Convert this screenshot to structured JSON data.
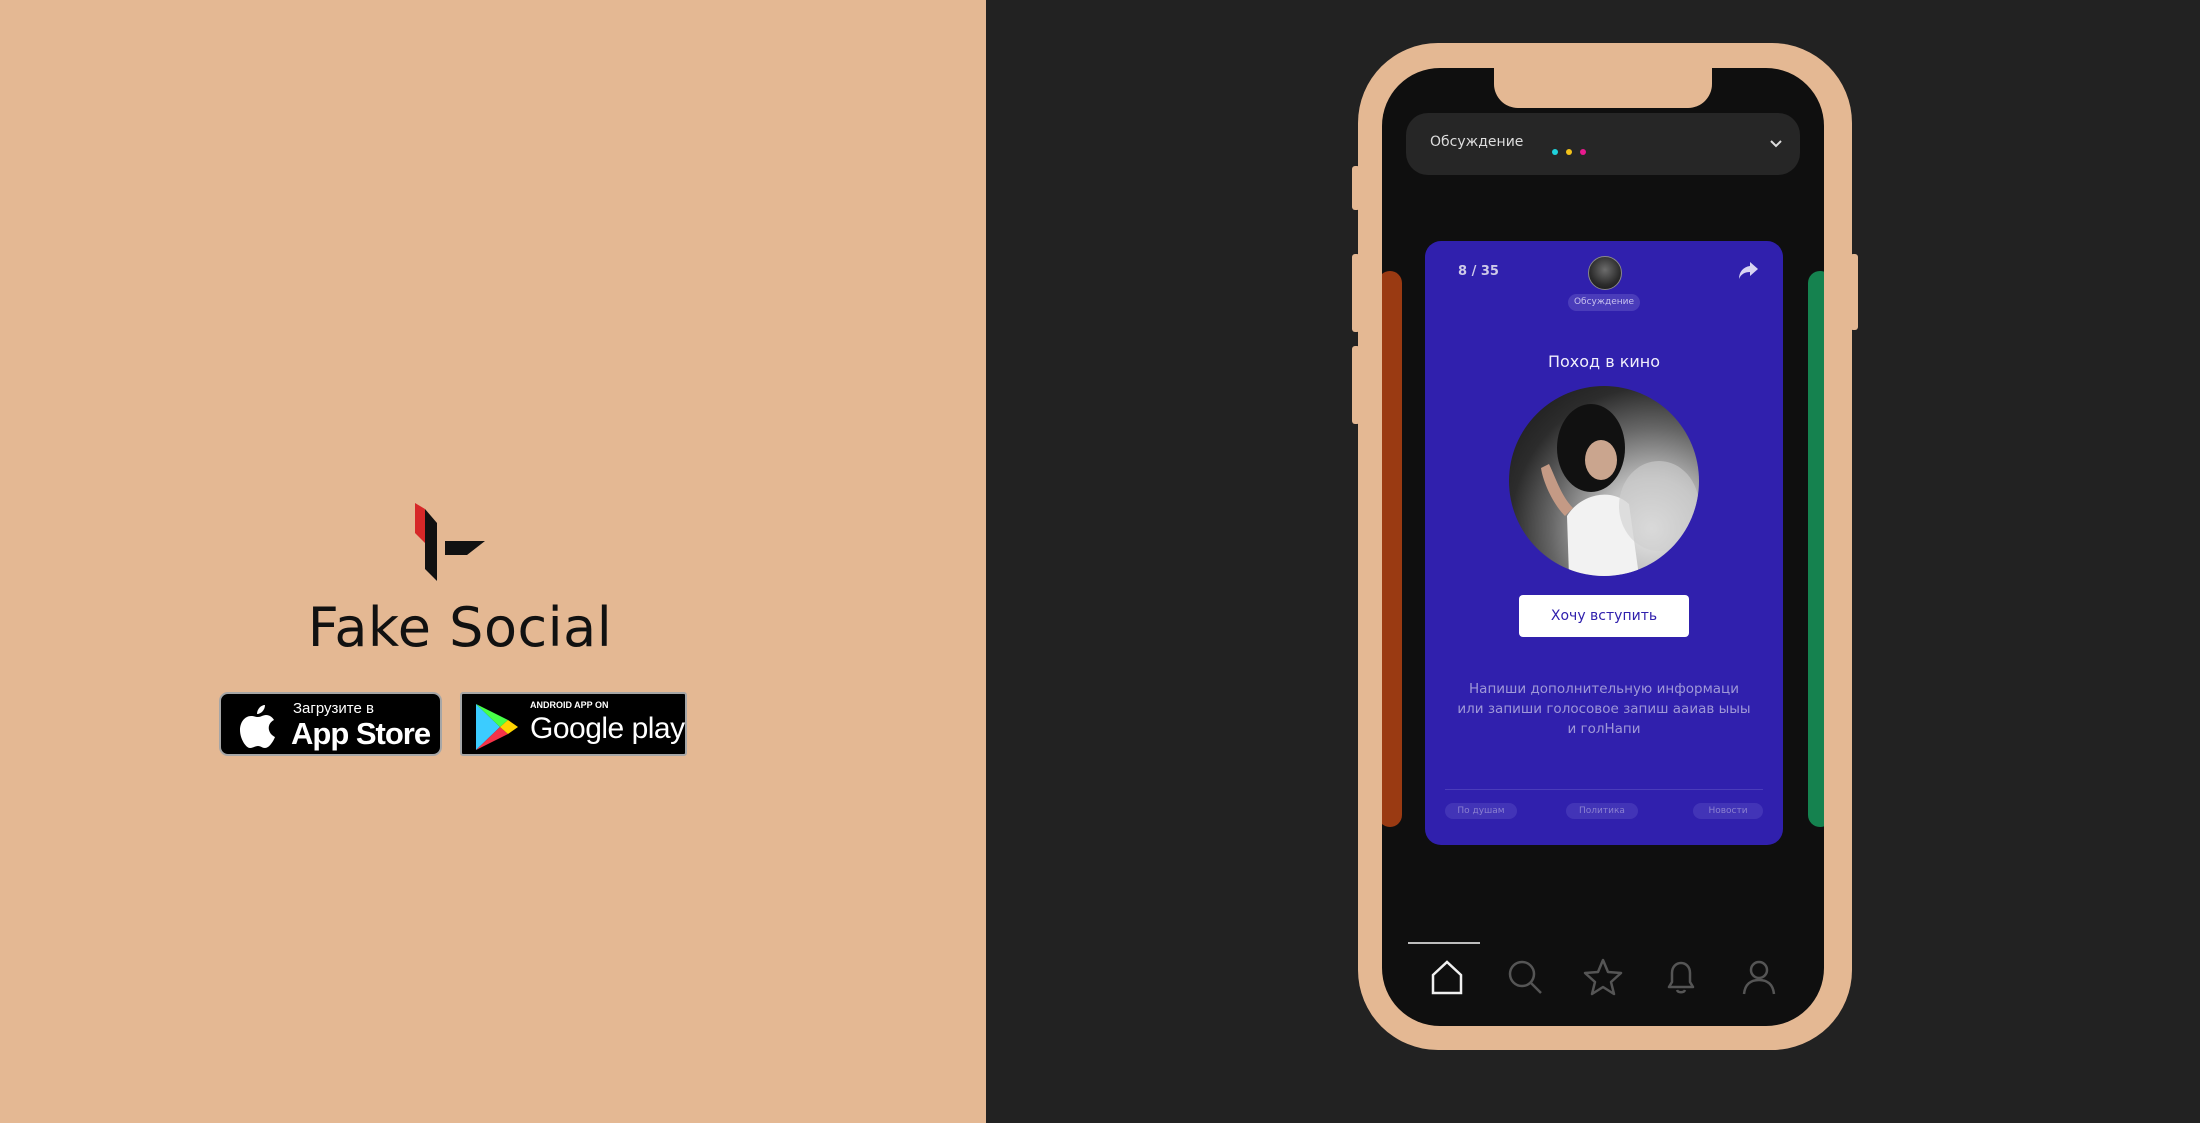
{
  "brand": {
    "name": "Fake Social"
  },
  "stores": {
    "appstore": {
      "small": "Загрузите в",
      "big": "App Store",
      "icon": "apple-icon"
    },
    "googleplay": {
      "small": "ANDROID APP ON",
      "big": "Google play",
      "icon": "google-play-icon"
    }
  },
  "colors": {
    "left_bg": "#e4b893",
    "right_bg": "#222222",
    "card_bg": "#3020ad",
    "left_card": "#9a3a12",
    "right_card": "#15824f",
    "dots": [
      "#1fd2dc",
      "#f2c21a",
      "#e81a8e"
    ]
  },
  "app": {
    "topbar": {
      "label": "Обсуждение"
    },
    "card": {
      "counter": "8 / 35",
      "category": "Обсуждение",
      "title": "Поход в кино",
      "join_button": "Хочу вступить",
      "description": "Напиши дополнительную информаци или запиши голосовое  запиш ааиав ыыы и голНапи",
      "tags": [
        "По душам",
        "Политика",
        "Новости"
      ]
    },
    "nav": [
      "home-icon",
      "search-icon",
      "star-icon",
      "bell-icon",
      "user-icon"
    ]
  }
}
